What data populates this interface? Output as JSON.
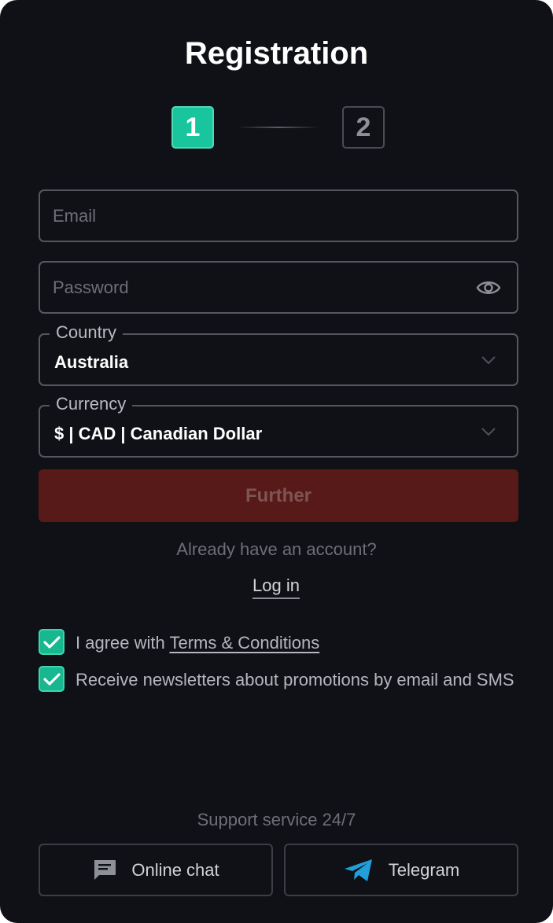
{
  "page": {
    "title": "Registration"
  },
  "steps": {
    "step1": "1",
    "step2": "2",
    "active": 1
  },
  "form": {
    "email_placeholder": "Email",
    "password_placeholder": "Password",
    "country_label": "Country",
    "country_value": "Australia",
    "currency_label": "Currency",
    "currency_value": "$ | CAD | Canadian Dollar",
    "further_label": "Further"
  },
  "account": {
    "already_text": "Already have an account?",
    "login_label": "Log in"
  },
  "checkboxes": {
    "terms_prefix": "I agree with ",
    "terms_link": "Terms & Conditions",
    "terms_checked": true,
    "newsletter_text": "Receive newsletters about promotions by email and SMS",
    "newsletter_checked": true
  },
  "support": {
    "title": "Support service 24/7",
    "chat_label": "Online chat",
    "telegram_label": "Telegram"
  },
  "icons": {
    "password_toggle": "eye-icon",
    "dropdown": "chevron-down-icon",
    "check": "check-icon",
    "chat": "chat-icon",
    "telegram": "telegram-icon"
  },
  "colors": {
    "accent": "#19c59c",
    "button_disabled": "#581a18",
    "background": "#101116",
    "telegram": "#229ed9"
  }
}
